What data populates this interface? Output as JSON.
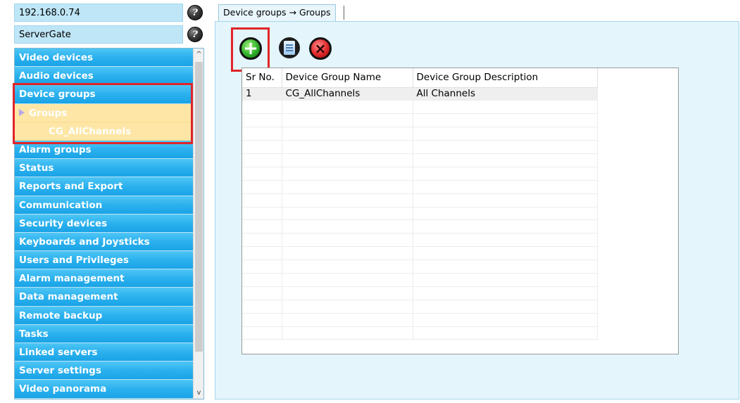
{
  "server": {
    "address": "192.168.0.74",
    "name": "ServerGate",
    "help_icon": "help-icon"
  },
  "nav": {
    "items_before": [
      "Video devices",
      "Audio devices",
      "Device groups"
    ],
    "sub_groups": "Groups",
    "sub_leaf": "CG_AllChannels",
    "items_after": [
      "Alarm groups",
      "Status",
      "Reports and Export",
      "Communication",
      "Security devices",
      "Keyboards and Joysticks",
      "Users and Privileges",
      "Alarm management",
      "Data management",
      "Remote backup",
      "Tasks",
      "Linked servers",
      "Server settings",
      "Video panorama"
    ],
    "scroll_up": "^",
    "scroll_down": "v"
  },
  "tab": {
    "label": "Device groups → Groups"
  },
  "toolbar": {
    "add_icon": "add-icon",
    "edit_icon": "edit-icon",
    "delete_icon": "delete-icon"
  },
  "table": {
    "headers": [
      "Sr No.",
      "Device Group Name",
      "Device Group Description"
    ],
    "rows": [
      [
        "1",
        "CG_AllChannels",
        "All Channels"
      ]
    ]
  },
  "colors": {
    "nav_item": "#2bb1ee",
    "nav_selected_sub": "#fde6a6",
    "highlight_box": "#e0242a",
    "content_bg": "#e4f5fc"
  }
}
